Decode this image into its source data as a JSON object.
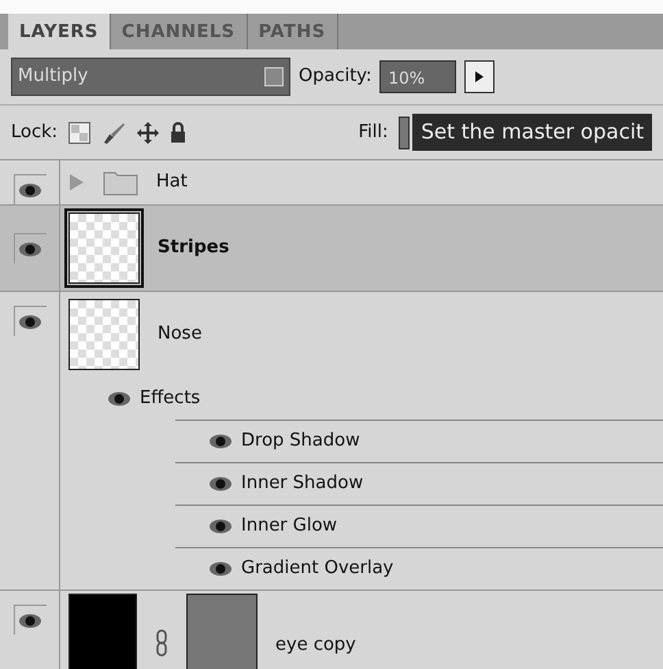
{
  "tabs": [
    {
      "label": "LAYERS",
      "selected": true
    },
    {
      "label": "CHANNELS",
      "selected": false
    },
    {
      "label": "PATHS",
      "selected": false
    }
  ],
  "blend_mode": "Multiply",
  "opacity": {
    "label": "Opacity:",
    "value": "10%"
  },
  "lock": {
    "label": "Lock:"
  },
  "fill": {
    "label": "Fill:"
  },
  "tooltip": "Set the master opacit",
  "layers": [
    {
      "kind": "group",
      "name": "Hat",
      "visible": true,
      "selected": false,
      "expanded": false
    },
    {
      "kind": "layer",
      "name": "Stripes",
      "visible": true,
      "selected": true
    },
    {
      "kind": "layer",
      "name": "Nose",
      "visible": true,
      "selected": false,
      "effects": {
        "label": "Effects",
        "visible": true,
        "items": [
          {
            "name": "Drop Shadow",
            "visible": true
          },
          {
            "name": "Inner Shadow",
            "visible": true
          },
          {
            "name": "Inner Glow",
            "visible": true
          },
          {
            "name": "Gradient Overlay",
            "visible": true
          }
        ]
      }
    },
    {
      "kind": "masked",
      "name": "eye copy",
      "visible": true,
      "selected": false
    }
  ]
}
